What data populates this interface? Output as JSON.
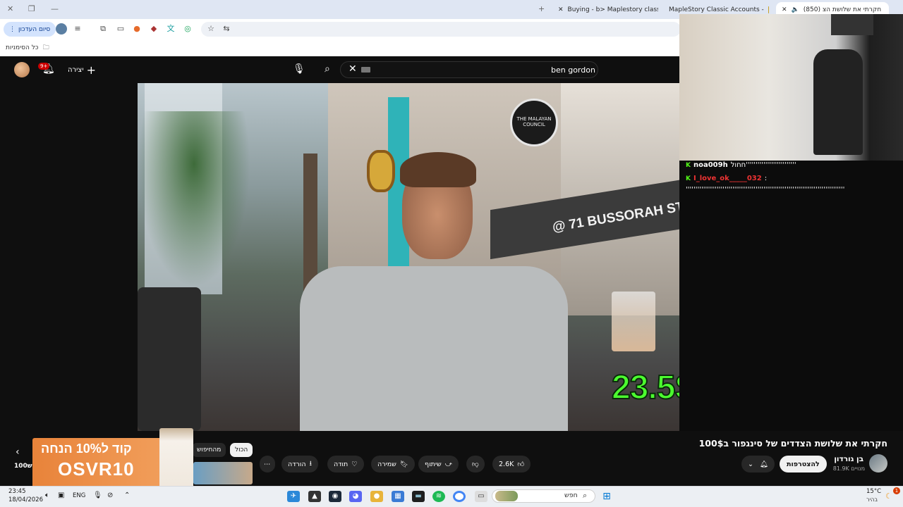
{
  "browser": {
    "tabs": [
      {
        "label": "(850) חקרתי את שלושת הצ",
        "active": true
      },
      {
        "label": "MapleStory Classic Accounts -",
        "active": false
      },
      {
        "label": "Buying - b> Maplestory classic",
        "active": false
      }
    ],
    "finish_update_label": "סיום העדכון",
    "all_bookmarks_label": "כל הסימניות"
  },
  "youtube": {
    "search_value": "ben gordon",
    "create_label": "יצירה",
    "notifications_badge": "9+",
    "video_overlay_price": "23.5S$",
    "sign_text": "@ 71 BUSSORAH ST",
    "logo_text": "THE MALAYAN COUNCIL",
    "video_title": "חקרתי את שלושת הצדדים של סינגפור ב100$",
    "channel_name": "בן גורדון",
    "channel_subs": "81.9K מנויים",
    "subscribe_label": "להצטרפות",
    "likes": "2.6K",
    "share_label": "שיתוף",
    "save_label": "שמירה",
    "thanks_label": "תודה",
    "download_label": "הורדה",
    "chips": [
      "הכול",
      "מהחיפוש"
    ],
    "side_label": "100ש"
  },
  "ad": {
    "line1": "קוד ל10% הנחה",
    "line2": "OSVR10"
  },
  "chat": {
    "messages": [
      {
        "user": "noa009h",
        "text": "חחול''''''''''''''''''''''''''"
      },
      {
        "user": "I_love_ok_____032",
        "text": ""
      },
      {
        "user": "",
        "text": "''''''''''''''''''''''''''''''''''''''''''''''''''''''''''''''''''''''''''''''''''"
      }
    ]
  },
  "taskbar": {
    "search_label": "חפש",
    "time": "23:45",
    "date": "18/04/2026",
    "language": "ENG",
    "weather_temp": "15°C",
    "weather_desc": "בהיר",
    "notification_count": "1"
  },
  "colors": {
    "accent_green": "#4cff2f",
    "kick_green": "#53fc18",
    "youtube_red": "#cc0000"
  }
}
